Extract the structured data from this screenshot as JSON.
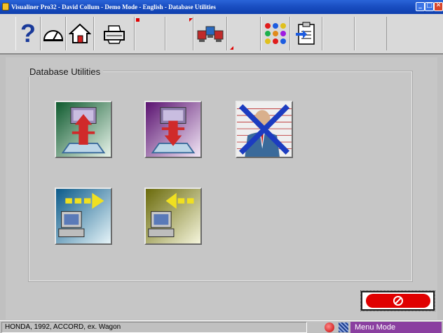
{
  "window": {
    "title": "Visualiner Pro32 - David Collum - Demo Mode - English - Database Utilities",
    "buttons": [
      "minimize",
      "maximize",
      "close"
    ]
  },
  "toolbar": {
    "help_glyph": "?",
    "items": [
      {
        "name": "help-icon"
      },
      {
        "name": "gauge-icon"
      },
      {
        "name": "home-icon"
      },
      {
        "name": "printer-icon"
      },
      {
        "name": "blank-button"
      },
      {
        "name": "blank-button"
      },
      {
        "name": "cars-icon"
      },
      {
        "name": "blank-button"
      },
      {
        "name": "colored-dots-icon"
      },
      {
        "name": "clipboard-arrow-icon"
      },
      {
        "name": "blank-button"
      },
      {
        "name": "blank-button"
      }
    ]
  },
  "main": {
    "panel_title": "Database Utilities",
    "utilities": [
      {
        "name": "backup-database-icon",
        "color": "#2e8b57"
      },
      {
        "name": "restore-database-icon",
        "color": "#8a3fa0"
      },
      {
        "name": "delete-customer-icon",
        "color": "#dcdcdc"
      },
      {
        "name": "export-data-icon",
        "color": "#1a9bd6"
      },
      {
        "name": "import-data-icon",
        "color": "#b8b21a"
      }
    ]
  },
  "cancel_button": {
    "name": "cancel-icon"
  },
  "status": {
    "vehicle": "HONDA, 1992, ACCORD, ex. Wagon",
    "mode": "Menu Mode"
  }
}
